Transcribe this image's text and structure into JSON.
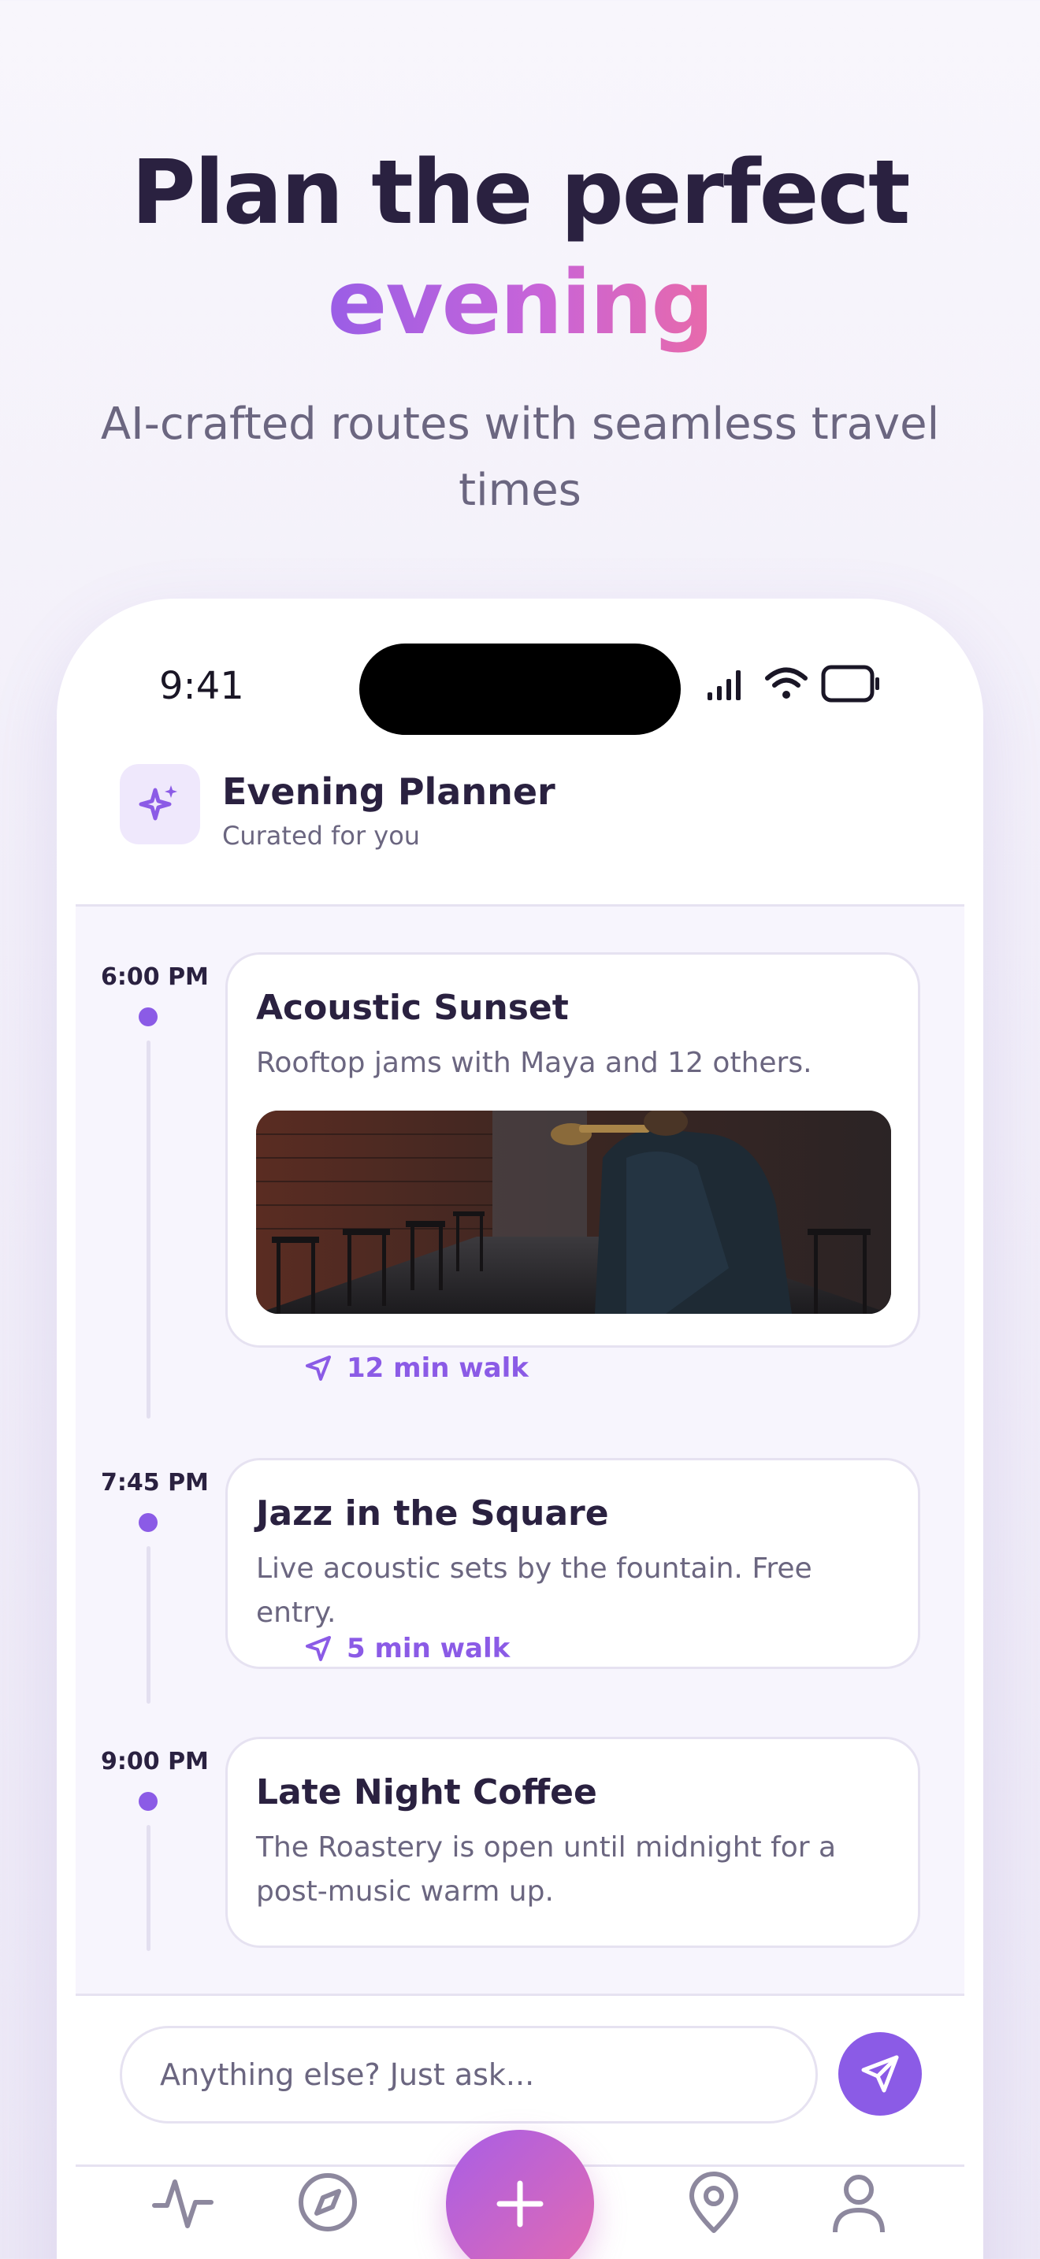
{
  "hero": {
    "title_line1": "Plan the perfect",
    "title_line2": "evening",
    "subtitle": "AI-crafted routes with seamless travel times"
  },
  "status_bar": {
    "time": "9:41",
    "icons": [
      "signal-icon",
      "wifi-icon",
      "battery-icon"
    ]
  },
  "header": {
    "icon": "sparkles-icon",
    "title": "Evening Planner",
    "subtitle": "Curated for you"
  },
  "timeline": [
    {
      "time": "6:00 PM",
      "title": "Acoustic Sunset",
      "description": "Rooftop jams with Maya and 12 others.",
      "image": "trumpet player in alley"
    },
    {
      "time": "7:45 PM",
      "title": "Jazz in the Square",
      "description": "Live acoustic sets by the fountain. Free entry."
    },
    {
      "time": "9:00 PM",
      "title": "Late Night Coffee",
      "description": "The Roastery is open until midnight for a post-music warm up."
    }
  ],
  "walks": [
    {
      "label": "12 min walk",
      "icon": "navigation-arrow-icon"
    },
    {
      "label": "5 min walk",
      "icon": "navigation-arrow-icon"
    }
  ],
  "ask": {
    "placeholder": "Anything else? Just ask...",
    "send_icon": "send-icon"
  },
  "tab_bar": {
    "tabs": [
      "activity-icon",
      "compass-icon",
      "map-pin-icon",
      "user-icon"
    ],
    "fab_icon": "plus-icon"
  },
  "colors": {
    "accent": "#8b5be6",
    "gradient_start": "#9a5ee6",
    "gradient_end": "#e86aaa",
    "text_dark": "#2a2140",
    "text_muted": "#6b6680"
  }
}
